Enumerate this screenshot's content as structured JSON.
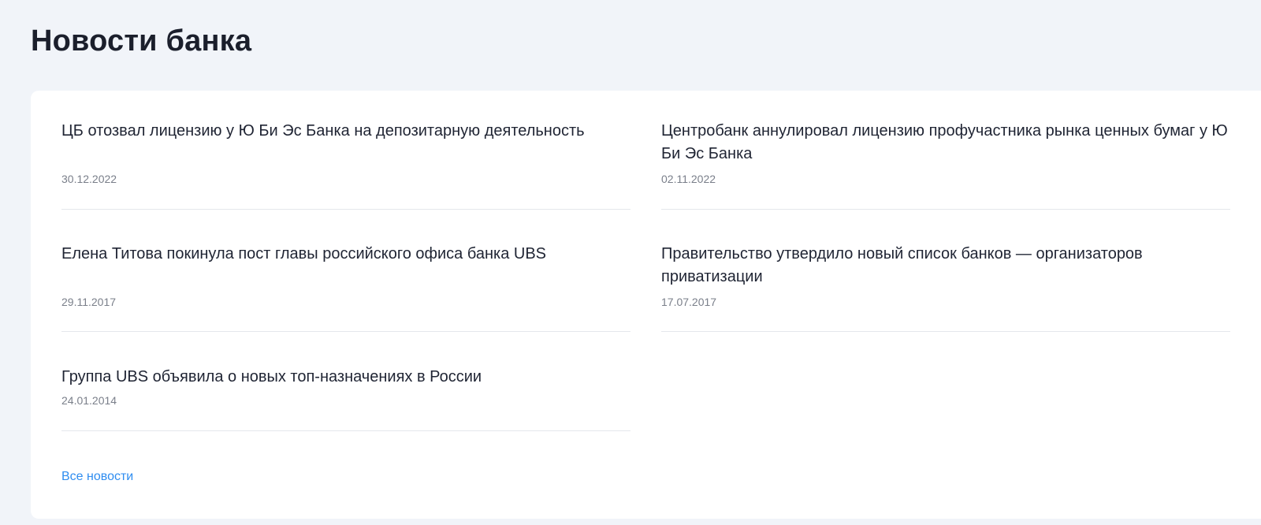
{
  "header": {
    "title": "Новости банка"
  },
  "news": {
    "items": [
      {
        "title": "ЦБ отозвал лицензию у Ю Би Эс Банка на депозитарную деятельность",
        "date": "30.12.2022"
      },
      {
        "title": "Центробанк аннулировал лицензию профучастника рынка ценных бумаг у Ю Би Эс Банка",
        "date": "02.11.2022"
      },
      {
        "title": "Елена Титова покинула пост главы российского офиса банка UBS",
        "date": "29.11.2017"
      },
      {
        "title": "Правительство утвердило новый список банков — организаторов приватизации",
        "date": "17.07.2017"
      },
      {
        "title": "Группа UBS объявила о новых топ-назначениях в России",
        "date": "24.01.2014"
      }
    ],
    "all_link_label": "Все новости"
  },
  "colors": {
    "page_background": "#f1f4f9",
    "card_background": "#ffffff",
    "title_text": "#1b1f2c",
    "date_text": "#7a7f8a",
    "link_accent": "#2f8df0",
    "divider": "#e4e7ec"
  }
}
